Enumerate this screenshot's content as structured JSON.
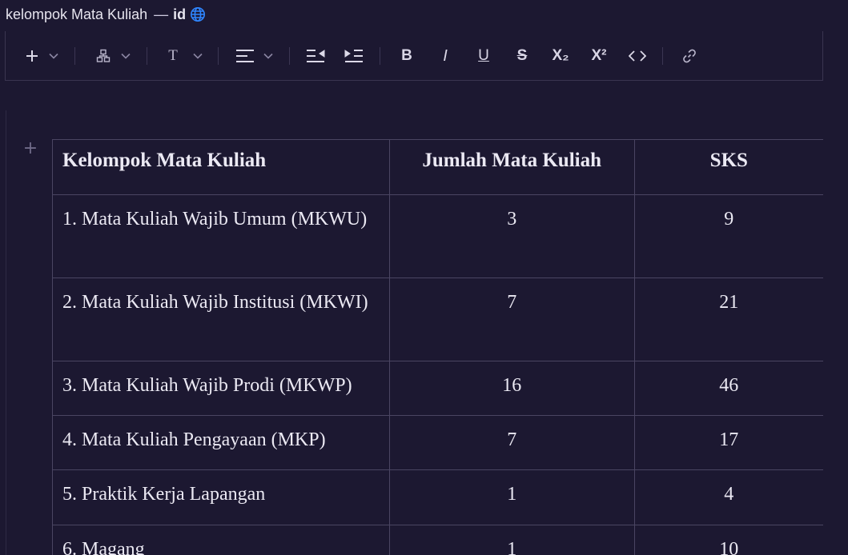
{
  "title": {
    "document_name": "kelompok Mata Kuliah",
    "separator": "—",
    "language": "id",
    "globe_icon": "globe-icon",
    "globe_color": "#2f86ff"
  },
  "toolbar": {
    "icons": [
      "plus-icon",
      "chevron-down-icon",
      "blocks-icon",
      "text-type-icon",
      "align-left-icon",
      "outdent-icon",
      "indent-icon",
      "bold-icon",
      "italic-icon",
      "underline-icon",
      "strikethrough-icon",
      "subscript-icon",
      "superscript-icon",
      "code-icon",
      "link-icon"
    ],
    "text_type_label": "T",
    "bold_label": "B",
    "italic_label": "I",
    "underline_label": "U",
    "strikethrough_label": "S",
    "subscript_label": "X₂",
    "superscript_label": "X²"
  },
  "table": {
    "headers": [
      "Kelompok Mata Kuliah",
      "Jumlah Mata Kuliah",
      "SKS"
    ],
    "rows": [
      {
        "group": "1. Mata Kuliah Wajib Umum (MKWU)",
        "count": "3",
        "sks": "9"
      },
      {
        "group": "2. Mata Kuliah Wajib Institusi (MKWI)",
        "count": "7",
        "sks": "21"
      },
      {
        "group": "3. Mata Kuliah Wajib Prodi (MKWP)",
        "count": "16",
        "sks": "46"
      },
      {
        "group": "4. Mata Kuliah Pengayaan (MKP)",
        "count": "7",
        "sks": "17"
      },
      {
        "group": "5. Praktik Kerja Lapangan",
        "count": "1",
        "sks": "4"
      },
      {
        "group": "6. Magang",
        "count": "1",
        "sks": "10"
      }
    ]
  },
  "colors": {
    "background": "#1c1831",
    "border": "#4a4562",
    "text": "#ebe9f3"
  }
}
